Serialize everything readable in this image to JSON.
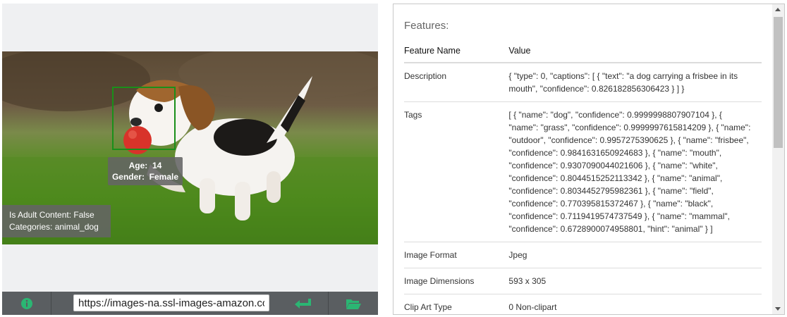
{
  "image_panel": {
    "face": {
      "age_label": "Age:",
      "age_value": "14",
      "gender_label": "Gender:",
      "gender_value": "Female"
    },
    "adult_content": "Is Adult Content: False",
    "categories": "Categories: animal_dog"
  },
  "toolbar": {
    "info_icon": "info-icon",
    "url_value": "https://images-na.ssl-images-amazon.com",
    "submit_icon": "enter-arrow-icon",
    "folder_icon": "open-folder-icon",
    "icon_color": "#2bb673"
  },
  "features": {
    "title": "Features:",
    "columns": [
      "Feature Name",
      "Value"
    ],
    "rows": [
      {
        "name": "Description",
        "value": "{ \"type\": 0, \"captions\": [ { \"text\": \"a dog carrying a frisbee in its mouth\", \"confidence\": 0.826182856306423 } ] }"
      },
      {
        "name": "Tags",
        "value": "[ { \"name\": \"dog\", \"confidence\": 0.9999998807907104 }, { \"name\": \"grass\", \"confidence\": 0.9999997615814209 }, { \"name\": \"outdoor\", \"confidence\": 0.9957275390625 }, { \"name\": \"frisbee\", \"confidence\": 0.9841631650924683 }, { \"name\": \"mouth\", \"confidence\": 0.9307090044021606 }, { \"name\": \"white\", \"confidence\": 0.8044515252113342 }, { \"name\": \"animal\", \"confidence\": 0.8034452795982361 }, { \"name\": \"field\", \"confidence\": 0.770395815372467 }, { \"name\": \"black\", \"confidence\": 0.7119419574737549 }, { \"name\": \"mammal\", \"confidence\": 0.6728900074958801, \"hint\": \"animal\" } ]"
      },
      {
        "name": "Image Format",
        "value": "Jpeg"
      },
      {
        "name": "Image Dimensions",
        "value": "593 x 305"
      },
      {
        "name": "Clip Art Type",
        "value": "0 Non-clipart"
      }
    ]
  }
}
